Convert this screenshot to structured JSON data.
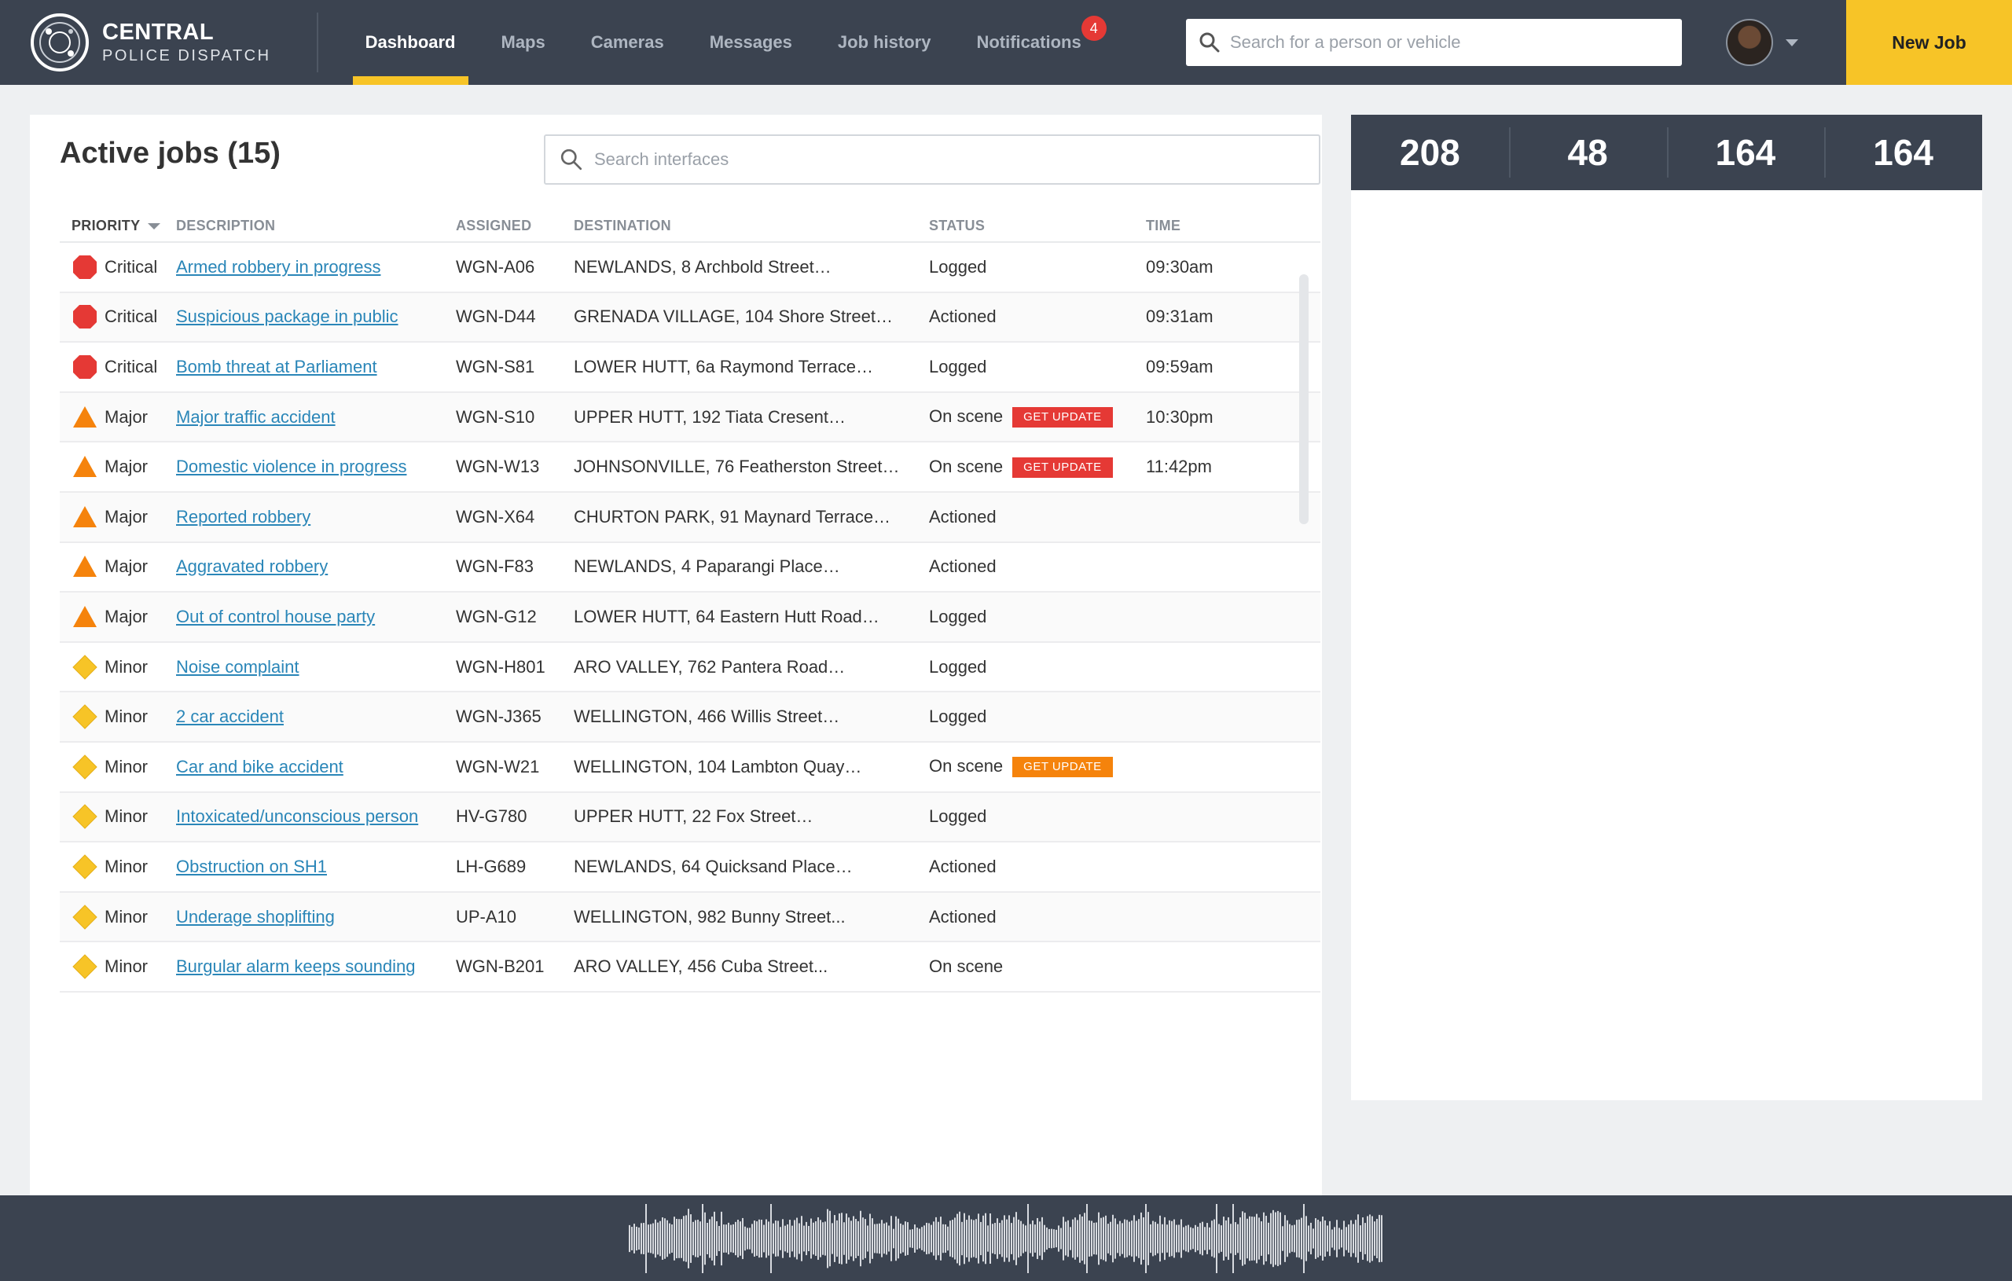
{
  "brand": {
    "line1": "CENTRAL",
    "line2": "POLICE DISPATCH"
  },
  "nav": {
    "items": [
      {
        "label": "Dashboard",
        "active": true
      },
      {
        "label": "Maps"
      },
      {
        "label": "Cameras"
      },
      {
        "label": "Messages"
      },
      {
        "label": "Job history"
      },
      {
        "label": "Notifications",
        "badge": "4"
      }
    ]
  },
  "search": {
    "placeholder": "Search for a person or vehicle"
  },
  "new_job_label": "New Job",
  "panel": {
    "title": "Active jobs (15)",
    "search_placeholder": "Search interfaces",
    "columns": {
      "priority": "PRIORITY",
      "description": "DESCRIPTION",
      "assigned": "ASSIGNED",
      "destination": "DESTINATION",
      "status": "STATUS",
      "time": "TIME"
    },
    "get_update_label": "GET UPDATE"
  },
  "jobs": [
    {
      "priority": "Critical",
      "description": "Armed robbery in progress",
      "assigned": "WGN-A06",
      "destination": "NEWLANDS, 8 Archbold Street…",
      "status": "Logged",
      "time": "09:30am",
      "update": ""
    },
    {
      "priority": "Critical",
      "description": "Suspicious package in public",
      "assigned": "WGN-D44",
      "destination": "GRENADA VILLAGE, 104 Shore Street…",
      "status": "Actioned",
      "time": "09:31am",
      "update": ""
    },
    {
      "priority": "Critical",
      "description": "Bomb threat at Parliament",
      "assigned": "WGN-S81",
      "destination": "LOWER HUTT, 6a Raymond Terrace…",
      "status": "Logged",
      "time": "09:59am",
      "update": ""
    },
    {
      "priority": "Major",
      "description": "Major traffic accident",
      "assigned": "WGN-S10",
      "destination": "UPPER HUTT, 192 Tiata Cresent…",
      "status": "On scene",
      "time": "10:30pm",
      "update": "red"
    },
    {
      "priority": "Major",
      "description": "Domestic violence in progress",
      "assigned": "WGN-W13",
      "destination": "JOHNSONVILLE, 76 Featherston Street…",
      "status": "On scene",
      "time": "11:42pm",
      "update": "red"
    },
    {
      "priority": "Major",
      "description": "Reported robbery",
      "assigned": "WGN-X64",
      "destination": "CHURTON PARK, 91 Maynard Terrace…",
      "status": "Actioned",
      "time": "",
      "update": ""
    },
    {
      "priority": "Major",
      "description": "Aggravated robbery",
      "assigned": "WGN-F83",
      "destination": "NEWLANDS, 4 Paparangi Place…",
      "status": "Actioned",
      "time": "",
      "update": ""
    },
    {
      "priority": "Major",
      "description": "Out of control house party",
      "assigned": "WGN-G12",
      "destination": "LOWER HUTT, 64 Eastern Hutt Road…",
      "status": "Logged",
      "time": "",
      "update": ""
    },
    {
      "priority": "Minor",
      "description": "Noise complaint",
      "assigned": "WGN-H801",
      "destination": "ARO VALLEY, 762 Pantera Road…",
      "status": "Logged",
      "time": "",
      "update": ""
    },
    {
      "priority": "Minor",
      "description": "2 car accident",
      "assigned": "WGN-J365",
      "destination": "WELLINGTON, 466 Willis Street…",
      "status": "Logged",
      "time": "",
      "update": ""
    },
    {
      "priority": "Minor",
      "description": "Car and bike accident",
      "assigned": "WGN-W21",
      "destination": "WELLINGTON, 104 Lambton Quay…",
      "status": "On scene",
      "time": "",
      "update": "orange"
    },
    {
      "priority": "Minor",
      "description": "Intoxicated/unconscious person",
      "assigned": "HV-G780",
      "destination": "UPPER HUTT, 22 Fox Street…",
      "status": "Logged",
      "time": "",
      "update": ""
    },
    {
      "priority": "Minor",
      "description": "Obstruction on SH1",
      "assigned": "LH-G689",
      "destination": "NEWLANDS, 64 Quicksand Place…",
      "status": "Actioned",
      "time": "",
      "update": ""
    },
    {
      "priority": "Minor",
      "description": "Underage shoplifting",
      "assigned": "UP-A10",
      "destination": "WELLINGTON, 982 Bunny Street...",
      "status": "Actioned",
      "time": "",
      "update": ""
    },
    {
      "priority": "Minor",
      "description": "Burgular alarm keeps sounding",
      "assigned": "WGN-B201",
      "destination": "ARO VALLEY, 456 Cuba Street...",
      "status": "On scene",
      "time": "",
      "update": ""
    }
  ],
  "stats": [
    "208",
    "48",
    "164",
    "164"
  ],
  "colors": {
    "accent": "#f7c427",
    "nav_bg": "#3b4350",
    "critical": "#e53935",
    "major": "#f5830c",
    "minor": "#f7c427",
    "link": "#2a86b8"
  }
}
